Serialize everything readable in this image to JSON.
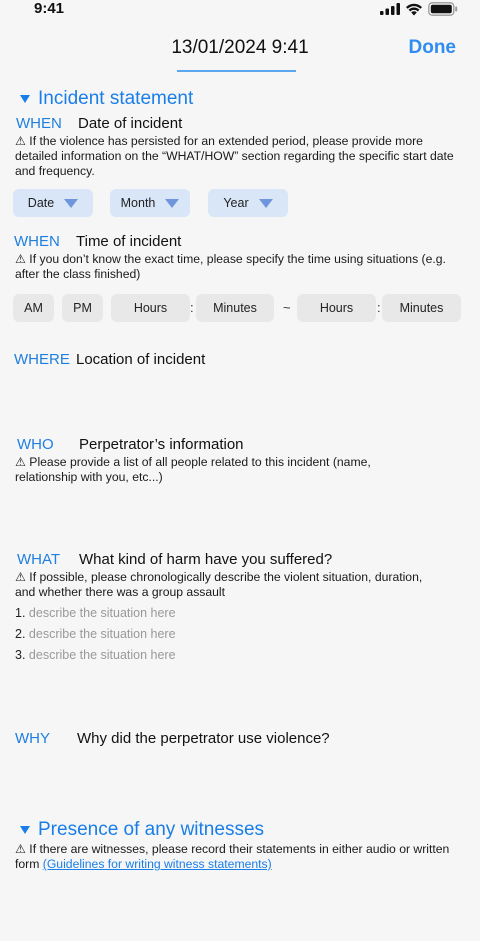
{
  "status": {
    "time": "9:41"
  },
  "nav": {
    "title": "13/01/2024 9:41",
    "done_label": "Done"
  },
  "incident": {
    "heading": "Incident statement",
    "date": {
      "key": "WHEN",
      "question": "Date of incident",
      "note": "⚠ If the violence has persisted for an extended period, please provide more detailed information on the “WHAT/HOW” section regarding the specific start date and frequency.",
      "dropdowns": [
        "Date",
        "Month",
        "Year"
      ]
    },
    "time": {
      "key": "WHEN",
      "question": "Time of incident",
      "note": "⚠ If you don’t know the exact time, please specify the time using situations (e.g. after the class finished)",
      "am": "AM",
      "pm": "PM",
      "hours": "Hours",
      "minutes": "Minutes",
      "colon": ":",
      "tilde": "~"
    },
    "where": {
      "key": "WHERE",
      "question": "Location of incident"
    },
    "who": {
      "key": "WHO",
      "question": "Perpetrator’s information",
      "note": "⚠ Please provide a list of all people related to this incident (name, relationship with you, etc...)"
    },
    "what": {
      "key": "WHAT",
      "question": "What kind of harm have you suffered?",
      "note": "⚠ If possible, please chronologically describe the violent situation, duration, and whether there was a group assault",
      "items": [
        {
          "num": "1.",
          "placeholder": "describe the situation here"
        },
        {
          "num": "2.",
          "placeholder": "describe the situation here"
        },
        {
          "num": "3.",
          "placeholder": "describe the situation here"
        }
      ]
    },
    "why": {
      "key": "WHY",
      "question": "Why did the perpetrator use violence?"
    }
  },
  "witness": {
    "heading": "Presence of any witnesses",
    "note": "⚠ If there are witnesses, please record their statements in either audio or written form",
    "link": "(Guidelines for writing witness statements)"
  },
  "colors": {
    "accent": "#1a7ee8",
    "dropdown_bg": "#d9e6f7",
    "pill_bg": "#e8e8e8"
  }
}
